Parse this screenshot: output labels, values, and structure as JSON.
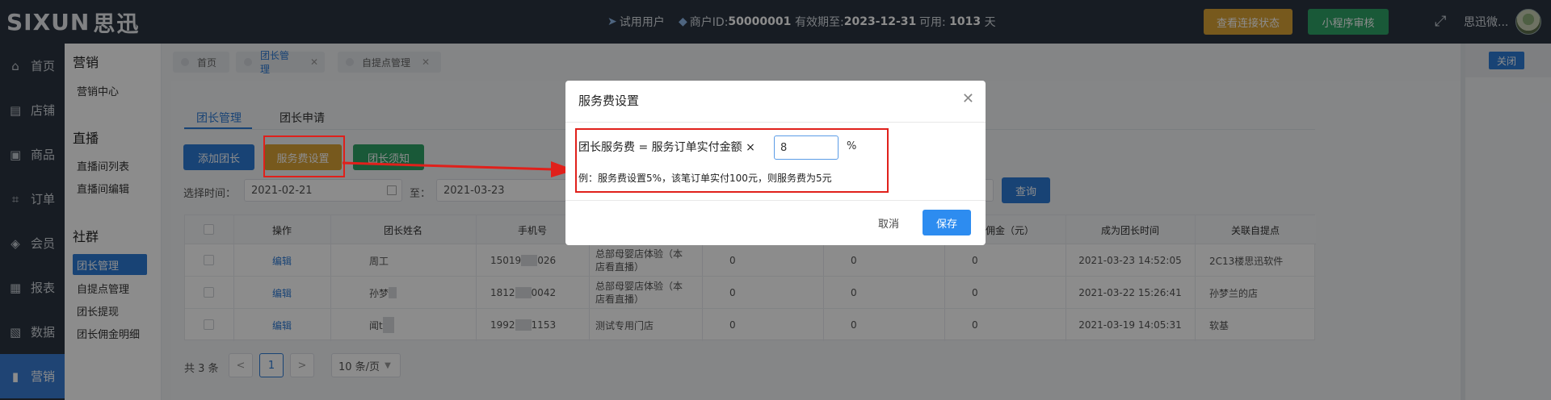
{
  "logo": {
    "latin": "SIXUN",
    "cn": "思迅"
  },
  "topbar": {
    "user_type": "试用用户",
    "merchant_label": "商户ID:",
    "merchant_id": "50000001",
    "expiry_label": "有效期至:",
    "expiry_date": "2023-12-31",
    "available_label": "可用:",
    "available_days": "1013",
    "available_unit": "天",
    "btn_connect": "查看连接状态",
    "btn_miniprogram": "小程序审核",
    "username": "思迅微..."
  },
  "sidebar": {
    "items": [
      {
        "label": "首页",
        "icon": "home-icon"
      },
      {
        "label": "店铺",
        "icon": "store-icon"
      },
      {
        "label": "商品",
        "icon": "gift-icon"
      },
      {
        "label": "订单",
        "icon": "order-icon"
      },
      {
        "label": "会员",
        "icon": "member-icon"
      },
      {
        "label": "报表",
        "icon": "report-icon"
      },
      {
        "label": "数据",
        "icon": "data-icon"
      },
      {
        "label": "营销",
        "icon": "chart-icon"
      }
    ]
  },
  "submenu": {
    "section1": "营销",
    "s1_items": [
      "营销中心"
    ],
    "section2": "直播",
    "s2_items": [
      "直播间列表",
      "直播间编辑"
    ],
    "section3": "社群",
    "s3_items": [
      "团长管理",
      "自提点管理",
      "团长提现",
      "团长佣金明细"
    ]
  },
  "tabs": [
    "首页",
    "团长管理",
    "自提点管理"
  ],
  "close_all": "关闭",
  "content_tabs": [
    "团长管理",
    "团长申请"
  ],
  "actions": {
    "add": "添加团长",
    "fee": "服务费设置",
    "notice": "团长须知",
    "query": "查询"
  },
  "filter": {
    "time_label": "选择时间：",
    "start": "2021-02-21",
    "to": "至：",
    "end": "2021-03-23"
  },
  "table": {
    "headers": [
      "操作",
      "团长姓名",
      "手机号",
      "",
      "",
      "",
      "算佣金（元）",
      "成为团长时间",
      "关联自提点"
    ],
    "rows": [
      {
        "op": "编辑",
        "name": "周工",
        "phone_a": "15019",
        "phone_b": "026",
        "store1": "总部母婴店体验（本",
        "store2": "店看直播）",
        "c1": "0",
        "c2": "0",
        "c3": "0",
        "time": "2021-03-23 14:52:05",
        "point": "2C13楼思迅软件"
      },
      {
        "op": "编辑",
        "name": "孙梦",
        "phone_a": "1812",
        "phone_b": "0042",
        "store1": "总部母婴店体验（本",
        "store2": "店看直播）",
        "c1": "0",
        "c2": "0",
        "c3": "0",
        "time": "2021-03-22 15:26:41",
        "point": "孙梦兰的店"
      },
      {
        "op": "编辑",
        "name": "闻t",
        "phone_a": "1992",
        "phone_b": "1153",
        "store1": "测试专用门店",
        "store2": "",
        "c1": "0",
        "c2": "0",
        "c3": "0",
        "time": "2021-03-19 14:05:31",
        "point": "软基"
      }
    ]
  },
  "pager": {
    "total": "共 3 条",
    "prev": "<",
    "page": "1",
    "next": ">",
    "size": "10 条/页"
  },
  "modal": {
    "title": "服务费设置",
    "formula": "团长服务费 = 服务订单实付金额 ×",
    "value": "8",
    "pct": "%",
    "example": "例：服务费设置5%，该笔订单实付100元，则服务费为5元",
    "cancel": "取消",
    "save": "保存"
  },
  "colors": {
    "accent": "#2d7ad6",
    "orange": "#d9a235",
    "green": "#2ea266",
    "annotation": "#e0201b"
  }
}
